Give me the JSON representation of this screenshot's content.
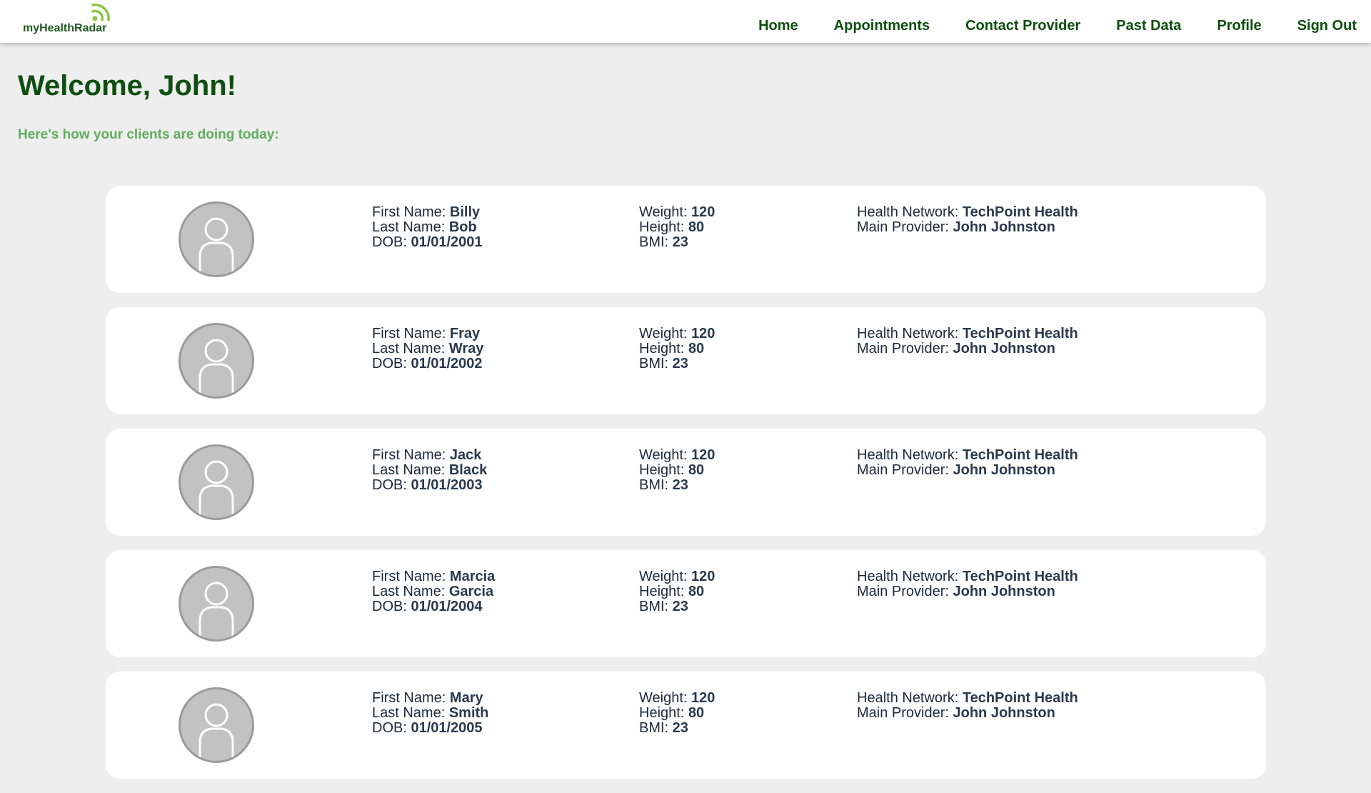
{
  "app": {
    "logo_text": "myHealthRadar",
    "brand_color": "#0c4f0c",
    "accent_color": "#8cc63f"
  },
  "nav": {
    "items": [
      {
        "label": "Home"
      },
      {
        "label": "Appointments"
      },
      {
        "label": "Contact Provider"
      },
      {
        "label": "Past Data"
      },
      {
        "label": "Profile"
      },
      {
        "label": "Sign Out"
      }
    ]
  },
  "main": {
    "title": "Welcome, John!",
    "subtitle": "Here's how your clients are doing today:"
  },
  "labels": {
    "first_name": "First Name: ",
    "last_name": "Last Name: ",
    "dob": "DOB: ",
    "weight": "Weight: ",
    "height": "Height: ",
    "bmi": "BMI: ",
    "health_network": "Health Network: ",
    "main_provider": "Main Provider: "
  },
  "clients": [
    {
      "first_name": "Billy",
      "last_name": "Bob",
      "dob": "01/01/2001",
      "weight": "120",
      "height": "80",
      "bmi": "23",
      "health_network": "TechPoint Health",
      "main_provider": "John Johnston"
    },
    {
      "first_name": "Fray",
      "last_name": "Wray",
      "dob": "01/01/2002",
      "weight": "120",
      "height": "80",
      "bmi": "23",
      "health_network": "TechPoint Health",
      "main_provider": "John Johnston"
    },
    {
      "first_name": "Jack",
      "last_name": "Black",
      "dob": "01/01/2003",
      "weight": "120",
      "height": "80",
      "bmi": "23",
      "health_network": "TechPoint Health",
      "main_provider": "John Johnston"
    },
    {
      "first_name": "Marcia",
      "last_name": "Garcia",
      "dob": "01/01/2004",
      "weight": "120",
      "height": "80",
      "bmi": "23",
      "health_network": "TechPoint Health",
      "main_provider": "John Johnston"
    },
    {
      "first_name": "Mary",
      "last_name": "Smith",
      "dob": "01/01/2005",
      "weight": "120",
      "height": "80",
      "bmi": "23",
      "health_network": "TechPoint Health",
      "main_provider": "John Johnston"
    }
  ],
  "icons": {
    "logo": "radar-signal-icon",
    "avatar": "user-avatar-icon"
  }
}
